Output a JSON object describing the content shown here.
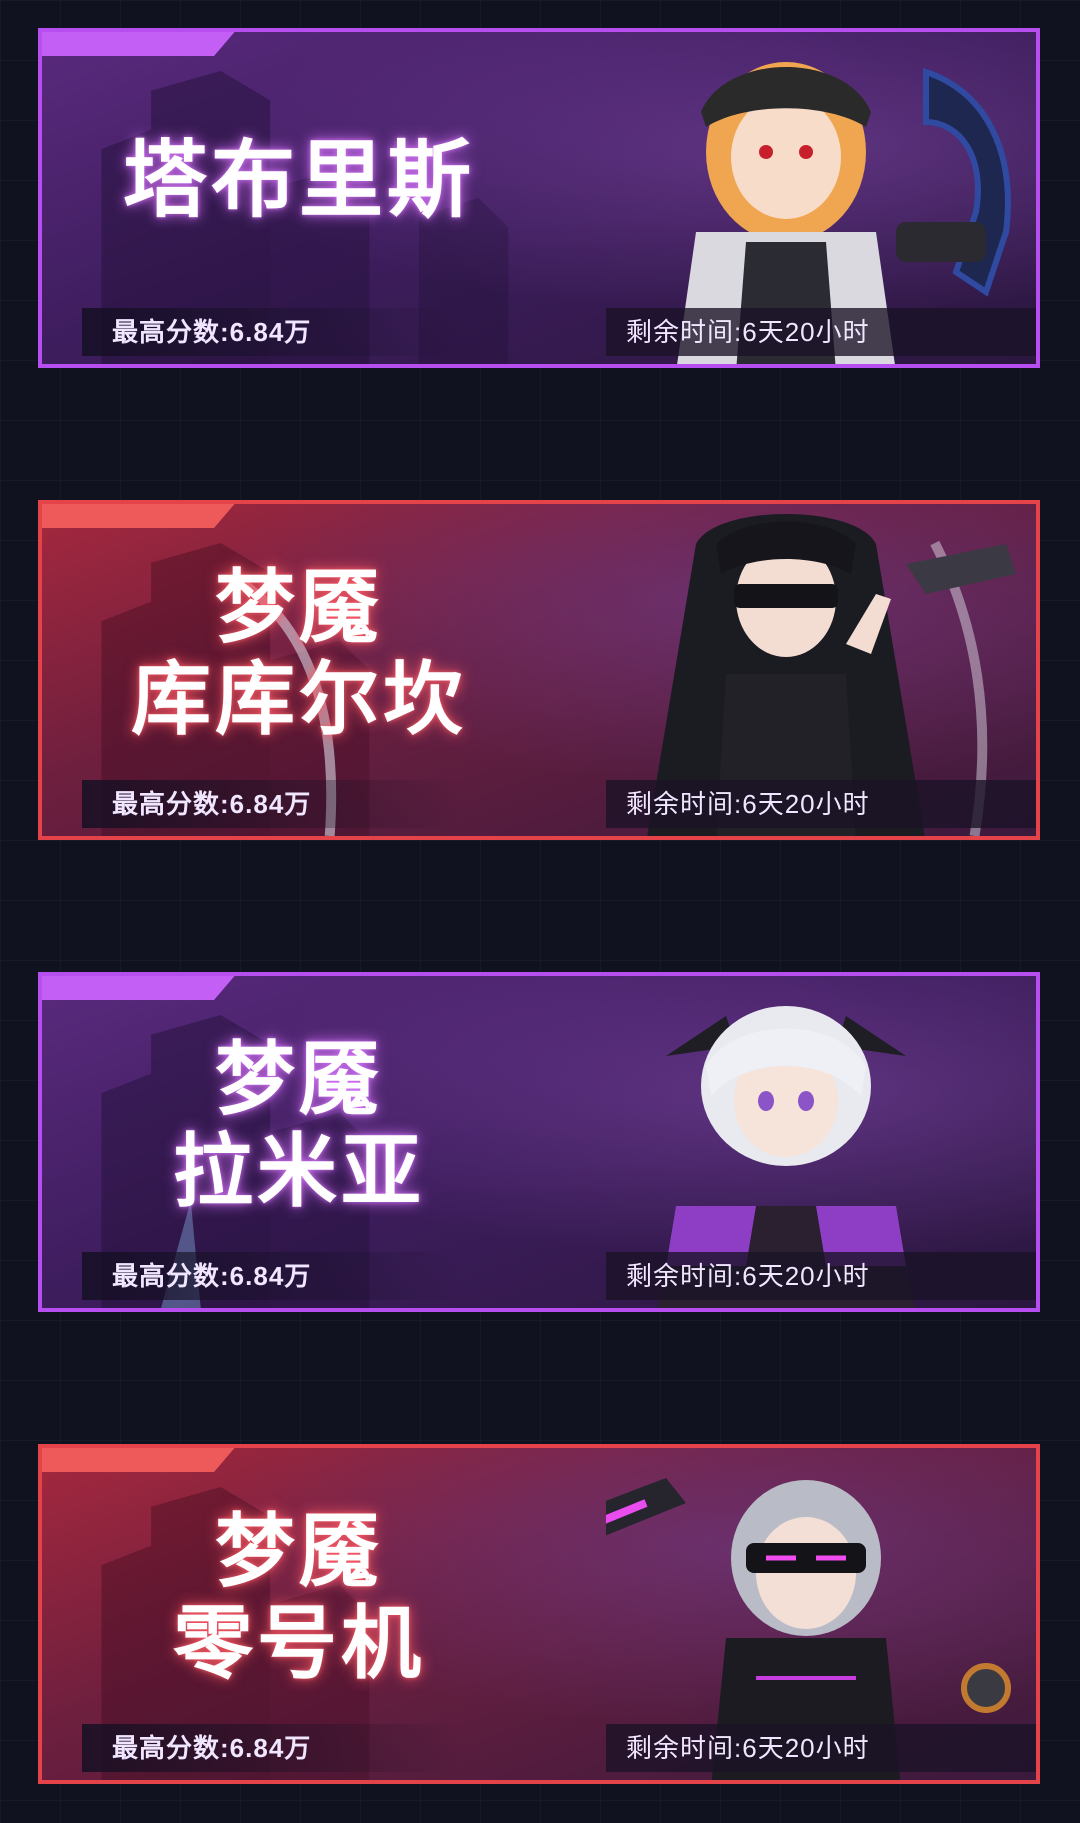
{
  "colors": {
    "background": "#10131f",
    "purple_border": "#b64ef0",
    "red_border": "#e5434a",
    "text": "#f1e6ff"
  },
  "cards": [
    {
      "theme": "purple",
      "title_lines": [
        "塔布里斯"
      ],
      "score_label": "最高分数:",
      "score_value": "6.84万",
      "timer_label": "剩余时间:",
      "timer_value": "6天20小时",
      "character_art": "blonde-girl-with-cap-and-mech-arm"
    },
    {
      "theme": "red",
      "title_lines": [
        "梦魇",
        "库库尔坎"
      ],
      "score_label": "最高分数:",
      "score_value": "6.84万",
      "timer_label": "剩余时间:",
      "timer_value": "6天20小时",
      "character_art": "long-black-hair-blindfolded-girl"
    },
    {
      "theme": "purple",
      "title_lines": [
        "梦魇",
        "拉米亚"
      ],
      "score_label": "最高分数:",
      "score_value": "6.84万",
      "timer_label": "剩余时间:",
      "timer_value": "6天20小时",
      "character_art": "white-hair-girl-with-horns"
    },
    {
      "theme": "red",
      "title_lines": [
        "梦魇",
        "零号机"
      ],
      "score_label": "最高分数:",
      "score_value": "6.84万",
      "timer_label": "剩余时间:",
      "timer_value": "6天20小时",
      "character_art": "silver-hair-visor-girl-with-cannon"
    }
  ]
}
